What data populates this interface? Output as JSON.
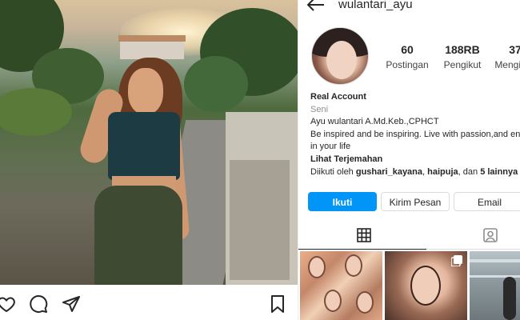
{
  "post": {
    "actions": {
      "like_icon": "heart-icon",
      "comment_icon": "comment-icon",
      "share_icon": "send-icon",
      "save_icon": "bookmark-icon"
    }
  },
  "profile": {
    "username": "wulantari_ayu",
    "stats": [
      {
        "value": "60",
        "label": "Postingan"
      },
      {
        "value": "188RB",
        "label": "Pengikut"
      },
      {
        "value": "37",
        "label": "Mengikuti"
      }
    ],
    "bio": {
      "name": "Real Account",
      "category": "Seni",
      "line1": "Ayu wulantari A.Md.Keb.,CPHCT",
      "line2": "Be inspired and be inspiring. Live with passion,and enjoy",
      "line3": "in your life",
      "translate": "Lihat Terjemahan",
      "followed_prefix": "Diikuti oleh ",
      "followed_user1": "gushari_kayana",
      "followed_sep1": ", ",
      "followed_user2": "haipuja",
      "followed_sep2": ", dan ",
      "followed_more": "5 lainnya"
    },
    "buttons": {
      "follow": "Ikuti",
      "message": "Kirim Pesan",
      "email": "Email"
    },
    "colors": {
      "follow_button": "#0095f6",
      "text": "#262626",
      "muted": "#8e8e8e"
    }
  }
}
